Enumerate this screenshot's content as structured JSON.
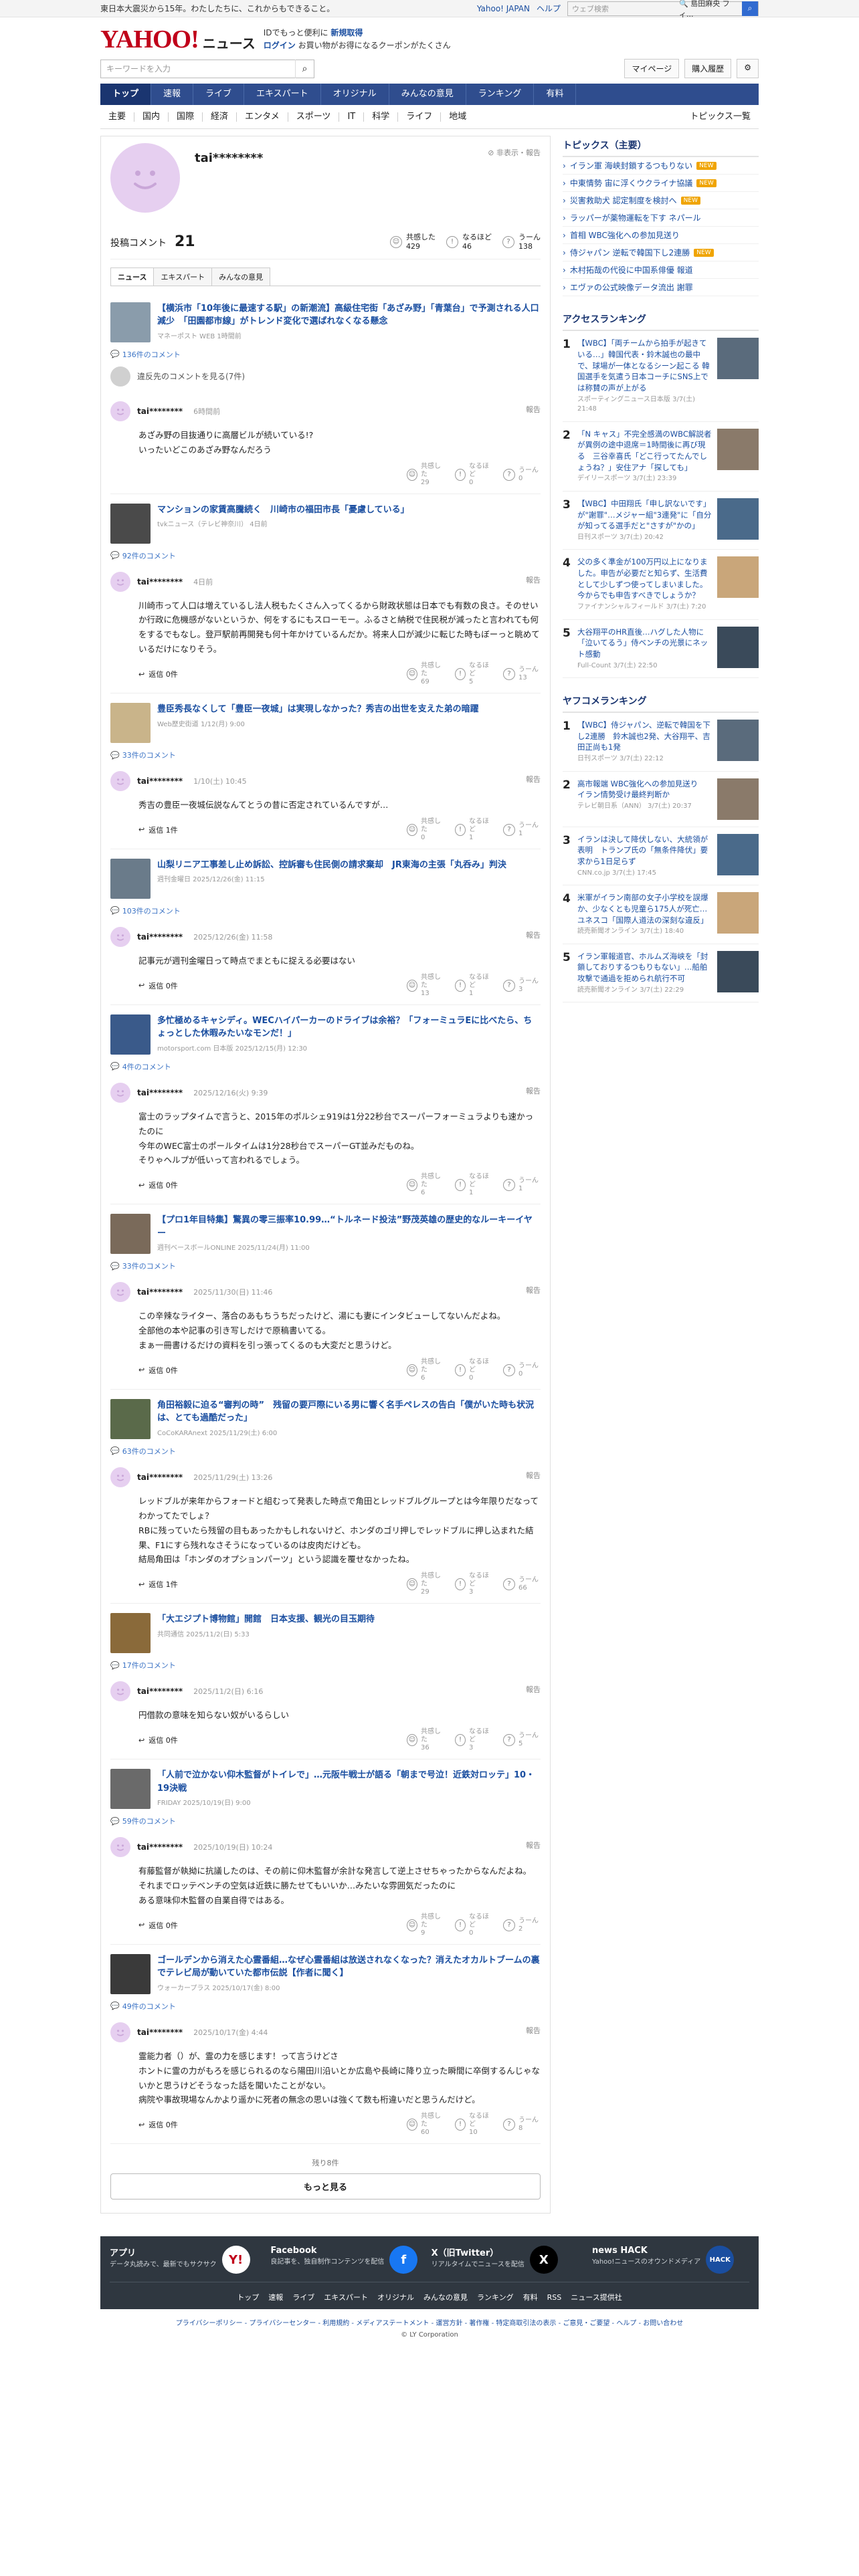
{
  "topbar": {
    "notice": "東日本大震災から15年。わたしたちに、これからもできること。",
    "links": [
      "Yahoo! JAPAN",
      "ヘルプ"
    ],
    "search_placeholder": "ウェブ検索",
    "search_suggest": "🔍 島田麻央 フィ..."
  },
  "masthead": {
    "logo": "YAHOO!",
    "logo_sub": "JAPAN",
    "service": "ニュース",
    "promo1": "IDでもっと便利に",
    "promo1_link": "新規取得",
    "promo2": "ログイン",
    "promo3": "お買い物がお得になるクーポンがたくさん"
  },
  "search": {
    "placeholder": "キーワードを入力",
    "mypage": "マイページ",
    "buy": "購入履歴"
  },
  "gnav": [
    "トップ",
    "速報",
    "ライブ",
    "エキスパート",
    "オリジナル",
    "みんなの意見",
    "ランキング",
    "有料"
  ],
  "catnav": [
    "主要",
    "国内",
    "国際",
    "経済",
    "エンタメ",
    "スポーツ",
    "IT",
    "科学",
    "ライフ",
    "地域"
  ],
  "catnav_right": "トピックス一覧",
  "profile": {
    "name": "tai********",
    "report": "非表示・報告",
    "count_label": "投稿コメント",
    "count": "21",
    "reactions": [
      {
        "label": "共感した",
        "value": "429"
      },
      {
        "label": "なるほど",
        "value": "46"
      },
      {
        "label": "うーん",
        "value": "138"
      }
    ],
    "tabs": [
      "ニュース",
      "エキスパート",
      "みんなの意見"
    ]
  },
  "hidden_text": "違反先のコメントを見る(7件)",
  "items": [
    {
      "title": "【横浜市「10年後に最速する駅」の新潮流】高級住宅街「あざみ野」「青葉台」で予測される人口減少　「田園都市線」がトレンド変化で選ばれなくなる懸念",
      "meta": "マネーポスト WEB 1時間前",
      "ccount": "136件のコメント",
      "date": "6時間前",
      "body": "あざみ野の目抜通りに高層ビルが続いている!?\nいったいどこのあざみ野なんだろう",
      "r": [
        "29",
        "0",
        "0"
      ],
      "reply": ""
    },
    {
      "title": "マンションの家賃高騰続く　川崎市の福田市長「憂慮している」",
      "meta": "tvkニュース（テレビ神奈川） 4日前",
      "ccount": "92件のコメント",
      "date": "4日前",
      "body": "川崎市って人口は増えているし法人税もたくさん入ってくるから財政状態は日本でも有数の良さ。そのせいか行政に危機感がないというか、何をするにもスローモー。ふるさと納税で住民税が減ったと言われても何をするでもなし。登戸駅前再開発も何十年かけているんだか。将来人口が減少に転じた時もぼーっと眺めているだけになりそう。",
      "r": [
        "69",
        "5",
        "13"
      ],
      "reply": "返信 0件"
    },
    {
      "title": "豊臣秀長なくして「豊臣一夜城」は実現しなかった？秀吉の出世を支えた弟の暗躍",
      "meta": "Web歴史街道 1/12(月) 9:00",
      "ccount": "33件のコメント",
      "date": "1/10(土) 10:45",
      "body": "秀吉の豊臣一夜城伝説なんてとうの昔に否定されているんですが…",
      "r": [
        "0",
        "1",
        "1"
      ],
      "reply": "返信 1件"
    },
    {
      "title": "山梨リニア工事差し止め訴訟、控訴審も住民側の請求棄却　JR東海の主張「丸呑み」判決",
      "meta": "週刊金曜日 2025/12/26(金) 11:15",
      "ccount": "103件のコメント",
      "date": "2025/12/26(金) 11:58",
      "body": "記事元が週刊金曜日って時点でまともに捉える必要はない",
      "r": [
        "13",
        "1",
        "3"
      ],
      "reply": "返信 0件"
    },
    {
      "title": "多忙極めるキャシディ。WECハイパーカーのドライブは余裕？「フォーミュラEに比べたら、ちょっとした休暇みたいなモンだ！」",
      "meta": "motorsport.com 日本版 2025/12/15(月) 12:30",
      "ccount": "4件のコメント",
      "date": "2025/12/16(火) 9:39",
      "body": "富士のラップタイムで言うと、2015年のポルシェ919は1分22秒台でスーパーフォーミュラよりも速かったのに\n今年のWEC富士のポールタイムは1分28秒台でスーパーGT並みだものね。\nそりゃヘルプが低いって言われるでしょう。",
      "r": [
        "6",
        "1",
        "1"
      ],
      "reply": "返信 0件"
    },
    {
      "title": "【プロ1年目特集】驚異の零三振率10.99…“トルネード投法”野茂英雄の歴史的なルーキーイヤー",
      "meta": "週刊ベースボールONLINE 2025/11/24(月) 11:00",
      "ccount": "33件のコメント",
      "date": "2025/11/30(日) 11:46",
      "body": "この辛辣なライター、落合のあもちうちだったけど、湯にも妻にインタビューしてないんだよね。\n全部他の本や記事の引き写しだけで原稿書いてる。\nまぁ一冊書けるだけの資料を引っ張ってくるのも大変だと思うけど。",
      "r": [
        "6",
        "0",
        "0"
      ],
      "reply": "返信 0件"
    },
    {
      "title": "角田裕毅に迫る“審判の時”　残留の要戸際にいる男に響く名手ペレスの告白「僕がいた時も状況は、とても過酷だった」",
      "meta": "CoCoKARAnext 2025/11/29(土) 6:00",
      "ccount": "63件のコメント",
      "date": "2025/11/29(土) 13:26",
      "body": "レッドブルが来年からフォードと組むって発表した時点で角田とレッドブルグループとは今年限りだなってわかってたでしょ？\nRBに残っていたら残留の目もあったかもしれないけど、ホンダのゴリ押しでレッドブルに押し込まれた結果、F1にすら残れなさそうになっているのは皮肉だけども。\n結局角田は「ホンダのオプションパーツ」という認識を覆せなかったね。",
      "r": [
        "29",
        "3",
        "66"
      ],
      "reply": "返信 1件"
    },
    {
      "title": "「大エジプト博物館」開館　日本支援、観光の目玉期待",
      "meta": "共同通信 2025/11/2(日) 5:33",
      "ccount": "17件のコメント",
      "date": "2025/11/2(日) 6:16",
      "body": "円借款の意味を知らない奴がいるらしい",
      "r": [
        "36",
        "3",
        "5"
      ],
      "reply": "返信 0件"
    },
    {
      "title": "「人前で泣かない仰木監督がトイレで」…元阪牛戦士が語る「朝まで号泣！近鉄対ロッテ」10・19決戦",
      "meta": "FRIDAY 2025/10/19(日) 9:00",
      "ccount": "59件のコメント",
      "date": "2025/10/19(日) 10:24",
      "body": "有藤監督が執拗に抗議したのは、その前に仰木監督が余計な発言して逆上させちゃったからなんだよね。\nそれまでロッテベンチの空気は近鉄に勝たせてもいいか…みたいな雰囲気だったのに\nある意味仰木監督の自業自得ではある。",
      "r": [
        "9",
        "0",
        "2"
      ],
      "reply": "返信 0件"
    },
    {
      "title": "ゴールデンから消えた心霊番組…なぜ心霊番組は放送されなくなった？消えたオカルトブームの裏でテレビ局が動いていた都市伝説【作者に聞く】",
      "meta": "ウォーカープラス 2025/10/17(金) 8:00",
      "ccount": "49件のコメント",
      "date": "2025/10/17(金) 4:44",
      "body": "霊能力者（）が、霊の力を感じます！って言うけどさ\nホントに霊の力がもろを感じられるのなら陽田川沿いとか広島や長崎に降り立った瞬間に卒倒するんじゃないかと思うけどそうなった話を聞いたことがない。\n病院や事故現場なんかより遥かに死者の無念の思いは強くて数も桁違いだと思うんだけど。",
      "r": [
        "60",
        "10",
        "8"
      ],
      "reply": "返信 0件"
    }
  ],
  "item_labels": {
    "report": "報告",
    "r_labels": [
      "共感した",
      "なるほど",
      "うーん"
    ]
  },
  "more": {
    "remain": "残り8件",
    "button": "もっと見る"
  },
  "side": {
    "topics_head": "トピックス（主要）",
    "topics": [
      {
        "t": "イラン軍 海峡封鎖するつもりない",
        "new": true
      },
      {
        "t": "中東情勢 宙に浮くウクライナ協議",
        "new": true
      },
      {
        "t": "災害救助犬 認定制度を検討へ",
        "new": true
      },
      {
        "t": "ラッパーが薬物運転を下す ネパール",
        "new": false
      },
      {
        "t": "首相 WBC強化への参加見送り",
        "new": false
      },
      {
        "t": "侍ジャパン 逆転で韓国下し2連勝",
        "new": true
      },
      {
        "t": "木村拓哉の代役に中国系俳優 報道",
        "new": false
      },
      {
        "t": "エヴァの公式映像データ流出 謝罪",
        "new": false
      }
    ],
    "access_head": "アクセスランキング",
    "access": [
      {
        "n": "1",
        "t": "【WBC】「両チームから拍手が起きている…」韓国代表・鈴木誠也の最中で、球場が一体となるシーン起こる 韓国選手を気遣う日本コーチにSNS上では称賛の声が上がる",
        "s": "スポーティングニュース日本版 3/7(土) 21:48"
      },
      {
        "n": "2",
        "t": "「N キャス」不完全感満のWBC解説者が異例の途中退席＝1時間後に再び現る　三谷幸喜氏「どこ行ってたんでしょうね？」安住アナ「探しても」",
        "s": "デイリースポーツ 3/7(土) 23:39"
      },
      {
        "n": "3",
        "t": "【WBC】中田翔氏「申し訳ないです」が\"謝罪\"…メジャー組\"3連発\"に「自分が知ってる選手だと\"さすが\"かの」",
        "s": "日刊スポーツ 3/7(土) 20:42"
      },
      {
        "n": "4",
        "t": "父の多く準金が100万円以上になりました。申告が必要だと知らず、生活費として少しずつ使ってしまいました。今からでも申告すべきでしょうか？",
        "s": "ファイナンシャルフィールド 3/7(土) 7:20"
      },
      {
        "n": "5",
        "t": "大谷翔平のHR直後…ハグした人物に「泣いてるう」侍ベンチの光景にネット感動",
        "s": "Full-Count 3/7(土) 22:50"
      }
    ],
    "yafoo_head": "ヤフコメランキング",
    "yafoo": [
      {
        "n": "1",
        "t": "【WBC】侍ジャパン、逆転で韓国を下し2連勝　鈴木誠也2発、大谷翔平、吉田正尚も1発",
        "s": "日刊スポーツ 3/7(土) 22:12"
      },
      {
        "n": "2",
        "t": "高市報端 WBC強化への参加見送り　イラン情勢受け最終判断か",
        "s": "テレビ朝日系（ANN） 3/7(土) 20:37"
      },
      {
        "n": "3",
        "t": "イランは決して降伏しない、大統領が表明　トランプ氏の「無条件降伏」要求から1日足らず",
        "s": "CNN.co.jp 3/7(土) 17:45"
      },
      {
        "n": "4",
        "t": "米軍がイラン南部の女子小学校を誤爆か、少なくとも児童ら175人が死亡…ユネスコ「国際人道法の深刻な違反」",
        "s": "読売新聞オンライン 3/7(土) 18:40"
      },
      {
        "n": "5",
        "t": "イラン軍報道官、ホルムズ海峡を「封鎖しておりするつもりもない」…船舶攻撃で通過を拒められ航行不可",
        "s": "読売新聞オンライン 3/7(土) 22:29"
      }
    ]
  },
  "footer": {
    "apps": [
      {
        "n": "アプリ",
        "d": "データ丸読みで、最新でもサクサク",
        "ic": "Y!",
        "c": "#ffffff",
        "fc": "#c0001a"
      },
      {
        "n": "Facebook",
        "d": "良記事を、独自制作コンテンツを配信",
        "ic": "f",
        "c": "#1877f2",
        "fc": "#ffffff"
      },
      {
        "n": "X（旧Twitter）",
        "d": "リアルタイムでニュースを配信",
        "ic": "X",
        "c": "#000000",
        "fc": "#ffffff"
      },
      {
        "n": "news HACK",
        "d": "Yahoo!ニュースのオウンドメディア",
        "ic": "HACK",
        "c": "#1a4ea0",
        "fc": "#ffffff"
      }
    ],
    "links": [
      "トップ",
      "速報",
      "ライブ",
      "エキスパート",
      "オリジナル",
      "みんなの意見",
      "ランキング",
      "有料",
      "RSS",
      "ニュース提供社"
    ],
    "legal": "プライバシーポリシー - プライバシーセンター - 利用規約 - メディアステートメント - 運営方針 - 著作権 - 特定商取引法の表示 - ご意見・ご要望 - ヘルプ - お問い合わせ",
    "copy": "© LY Corporation"
  },
  "colors": {
    "brand": "#c0001a",
    "nav": "#2f4d8e",
    "link": "#1a4ea0"
  }
}
